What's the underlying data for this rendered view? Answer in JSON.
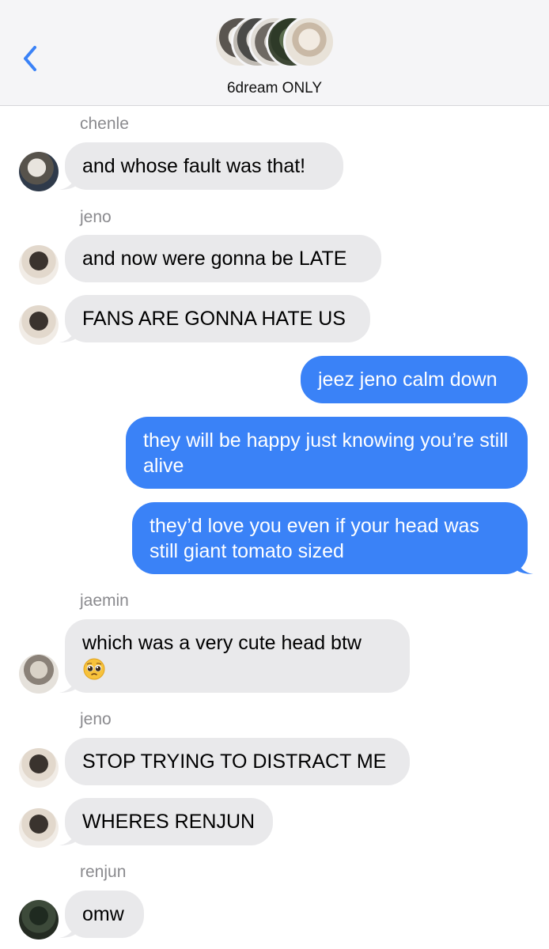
{
  "header": {
    "title": "6dream ONLY",
    "back_icon": "chevron-left-icon",
    "accent": "#3a82f7"
  },
  "colors": {
    "incoming_bubble": "#e9e9eb",
    "outgoing_bubble": "#3a82f7",
    "sender_label": "#8a8a8e"
  },
  "messages": [
    {
      "sender": "chenle",
      "text": "and whose fault was that!"
    },
    {
      "sender": "jeno",
      "text": "and now were gonna be LATE"
    },
    {
      "text": "FANS ARE GONNA HATE US"
    },
    {
      "outgoing": true,
      "text": "jeez jeno calm down"
    },
    {
      "outgoing": true,
      "text": "they will be happy just knowing you’re still alive"
    },
    {
      "outgoing": true,
      "text": "they’d love you even if your head was still giant tomato sized"
    },
    {
      "sender": "jaemin",
      "text": "which was a very cute head btw",
      "emoji": "pleading-face-emoji"
    },
    {
      "sender": "jeno",
      "text": "STOP TRYING TO DISTRACT ME"
    },
    {
      "text": "WHERES RENJUN"
    },
    {
      "sender": "renjun",
      "text": "omw"
    }
  ]
}
